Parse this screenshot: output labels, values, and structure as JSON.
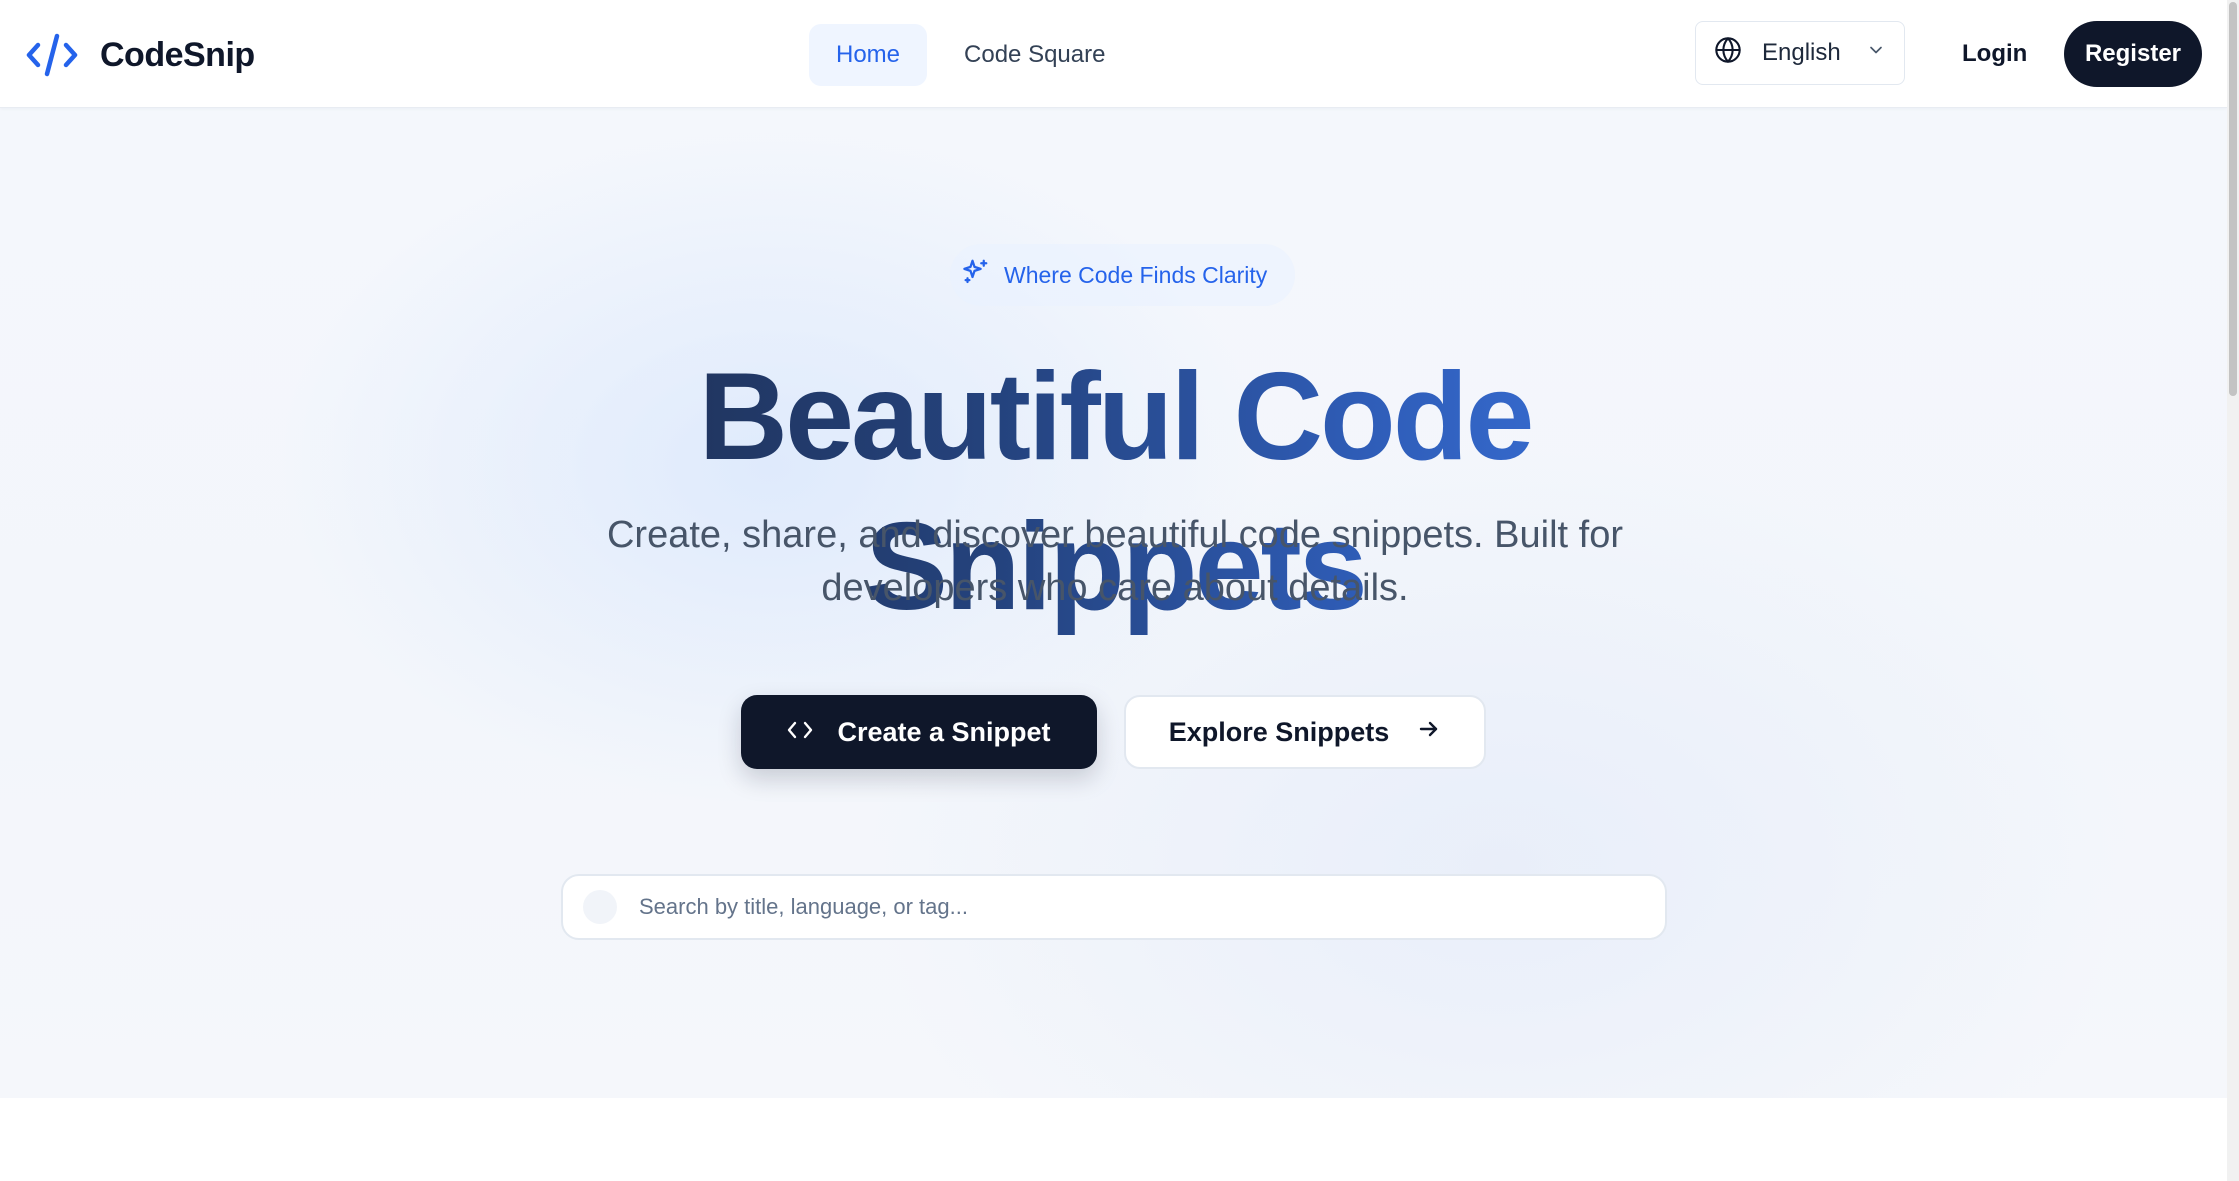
{
  "header": {
    "logo_text": "CodeSnip",
    "nav": [
      {
        "label": "Home",
        "active": true
      },
      {
        "label": "Code Square",
        "active": false
      }
    ],
    "language": {
      "selected": "English"
    },
    "login_label": "Login",
    "register_label": "Register"
  },
  "hero": {
    "tagline": "Where Code Finds Clarity",
    "title": "Beautiful Code Snippets",
    "subtitle": "Create, share, and discover beautiful code snippets. Built for developers who care about details.",
    "primary_button": "Create a Snippet",
    "secondary_button": "Explore Snippets",
    "search_placeholder": "Search by title, language, or tag..."
  },
  "colors": {
    "accent": "#2563eb",
    "dark": "#0f172a",
    "title_gradient_start": "#1e2d4d",
    "title_gradient_end": "#3b76e2"
  },
  "icons": {
    "logo": "code-brackets-icon",
    "tagline": "sparkles-icon",
    "language": "globe-icon",
    "dropdown": "chevron-down-icon",
    "primary_button": "code-icon",
    "secondary_button": "arrow-right-icon"
  }
}
